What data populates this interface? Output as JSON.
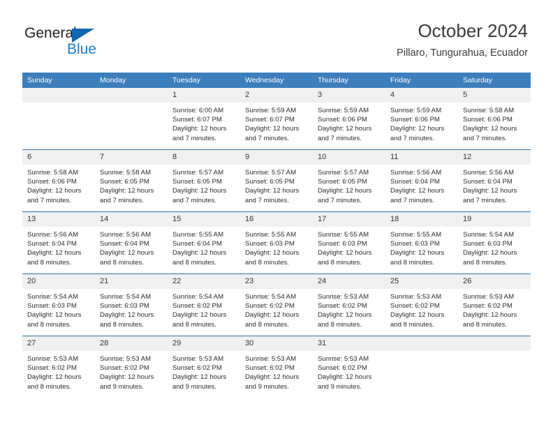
{
  "logo": {
    "primary_text": "General",
    "secondary_text": "Blue",
    "triangle_color": "#1166b0",
    "secondary_color": "#1e7ac4"
  },
  "header": {
    "title": "October 2024",
    "subtitle": "Pillaro, Tungurahua, Ecuador"
  },
  "theme": {
    "header_blue": "#3d7ebc",
    "row_divider_blue": "#2f6fa8",
    "daynum_bg": "#f0f0f0"
  },
  "weekday_headers": [
    "Sunday",
    "Monday",
    "Tuesday",
    "Wednesday",
    "Thursday",
    "Friday",
    "Saturday"
  ],
  "weeks": [
    [
      {
        "day": "",
        "lines": []
      },
      {
        "day": "",
        "lines": []
      },
      {
        "day": "1",
        "lines": [
          "Sunrise: 6:00 AM",
          "Sunset: 6:07 PM",
          "Daylight: 12 hours",
          "and 7 minutes."
        ]
      },
      {
        "day": "2",
        "lines": [
          "Sunrise: 5:59 AM",
          "Sunset: 6:07 PM",
          "Daylight: 12 hours",
          "and 7 minutes."
        ]
      },
      {
        "day": "3",
        "lines": [
          "Sunrise: 5:59 AM",
          "Sunset: 6:06 PM",
          "Daylight: 12 hours",
          "and 7 minutes."
        ]
      },
      {
        "day": "4",
        "lines": [
          "Sunrise: 5:59 AM",
          "Sunset: 6:06 PM",
          "Daylight: 12 hours",
          "and 7 minutes."
        ]
      },
      {
        "day": "5",
        "lines": [
          "Sunrise: 5:58 AM",
          "Sunset: 6:06 PM",
          "Daylight: 12 hours",
          "and 7 minutes."
        ]
      }
    ],
    [
      {
        "day": "6",
        "lines": [
          "Sunrise: 5:58 AM",
          "Sunset: 6:06 PM",
          "Daylight: 12 hours",
          "and 7 minutes."
        ]
      },
      {
        "day": "7",
        "lines": [
          "Sunrise: 5:58 AM",
          "Sunset: 6:05 PM",
          "Daylight: 12 hours",
          "and 7 minutes."
        ]
      },
      {
        "day": "8",
        "lines": [
          "Sunrise: 5:57 AM",
          "Sunset: 6:05 PM",
          "Daylight: 12 hours",
          "and 7 minutes."
        ]
      },
      {
        "day": "9",
        "lines": [
          "Sunrise: 5:57 AM",
          "Sunset: 6:05 PM",
          "Daylight: 12 hours",
          "and 7 minutes."
        ]
      },
      {
        "day": "10",
        "lines": [
          "Sunrise: 5:57 AM",
          "Sunset: 6:05 PM",
          "Daylight: 12 hours",
          "and 7 minutes."
        ]
      },
      {
        "day": "11",
        "lines": [
          "Sunrise: 5:56 AM",
          "Sunset: 6:04 PM",
          "Daylight: 12 hours",
          "and 7 minutes."
        ]
      },
      {
        "day": "12",
        "lines": [
          "Sunrise: 5:56 AM",
          "Sunset: 6:04 PM",
          "Daylight: 12 hours",
          "and 7 minutes."
        ]
      }
    ],
    [
      {
        "day": "13",
        "lines": [
          "Sunrise: 5:56 AM",
          "Sunset: 6:04 PM",
          "Daylight: 12 hours",
          "and 8 minutes."
        ]
      },
      {
        "day": "14",
        "lines": [
          "Sunrise: 5:56 AM",
          "Sunset: 6:04 PM",
          "Daylight: 12 hours",
          "and 8 minutes."
        ]
      },
      {
        "day": "15",
        "lines": [
          "Sunrise: 5:55 AM",
          "Sunset: 6:04 PM",
          "Daylight: 12 hours",
          "and 8 minutes."
        ]
      },
      {
        "day": "16",
        "lines": [
          "Sunrise: 5:55 AM",
          "Sunset: 6:03 PM",
          "Daylight: 12 hours",
          "and 8 minutes."
        ]
      },
      {
        "day": "17",
        "lines": [
          "Sunrise: 5:55 AM",
          "Sunset: 6:03 PM",
          "Daylight: 12 hours",
          "and 8 minutes."
        ]
      },
      {
        "day": "18",
        "lines": [
          "Sunrise: 5:55 AM",
          "Sunset: 6:03 PM",
          "Daylight: 12 hours",
          "and 8 minutes."
        ]
      },
      {
        "day": "19",
        "lines": [
          "Sunrise: 5:54 AM",
          "Sunset: 6:03 PM",
          "Daylight: 12 hours",
          "and 8 minutes."
        ]
      }
    ],
    [
      {
        "day": "20",
        "lines": [
          "Sunrise: 5:54 AM",
          "Sunset: 6:03 PM",
          "Daylight: 12 hours",
          "and 8 minutes."
        ]
      },
      {
        "day": "21",
        "lines": [
          "Sunrise: 5:54 AM",
          "Sunset: 6:03 PM",
          "Daylight: 12 hours",
          "and 8 minutes."
        ]
      },
      {
        "day": "22",
        "lines": [
          "Sunrise: 5:54 AM",
          "Sunset: 6:02 PM",
          "Daylight: 12 hours",
          "and 8 minutes."
        ]
      },
      {
        "day": "23",
        "lines": [
          "Sunrise: 5:54 AM",
          "Sunset: 6:02 PM",
          "Daylight: 12 hours",
          "and 8 minutes."
        ]
      },
      {
        "day": "24",
        "lines": [
          "Sunrise: 5:53 AM",
          "Sunset: 6:02 PM",
          "Daylight: 12 hours",
          "and 8 minutes."
        ]
      },
      {
        "day": "25",
        "lines": [
          "Sunrise: 5:53 AM",
          "Sunset: 6:02 PM",
          "Daylight: 12 hours",
          "and 8 minutes."
        ]
      },
      {
        "day": "26",
        "lines": [
          "Sunrise: 5:53 AM",
          "Sunset: 6:02 PM",
          "Daylight: 12 hours",
          "and 8 minutes."
        ]
      }
    ],
    [
      {
        "day": "27",
        "lines": [
          "Sunrise: 5:53 AM",
          "Sunset: 6:02 PM",
          "Daylight: 12 hours",
          "and 8 minutes."
        ]
      },
      {
        "day": "28",
        "lines": [
          "Sunrise: 5:53 AM",
          "Sunset: 6:02 PM",
          "Daylight: 12 hours",
          "and 9 minutes."
        ]
      },
      {
        "day": "29",
        "lines": [
          "Sunrise: 5:53 AM",
          "Sunset: 6:02 PM",
          "Daylight: 12 hours",
          "and 9 minutes."
        ]
      },
      {
        "day": "30",
        "lines": [
          "Sunrise: 5:53 AM",
          "Sunset: 6:02 PM",
          "Daylight: 12 hours",
          "and 9 minutes."
        ]
      },
      {
        "day": "31",
        "lines": [
          "Sunrise: 5:53 AM",
          "Sunset: 6:02 PM",
          "Daylight: 12 hours",
          "and 9 minutes."
        ]
      },
      {
        "day": "",
        "lines": []
      },
      {
        "day": "",
        "lines": []
      }
    ]
  ]
}
